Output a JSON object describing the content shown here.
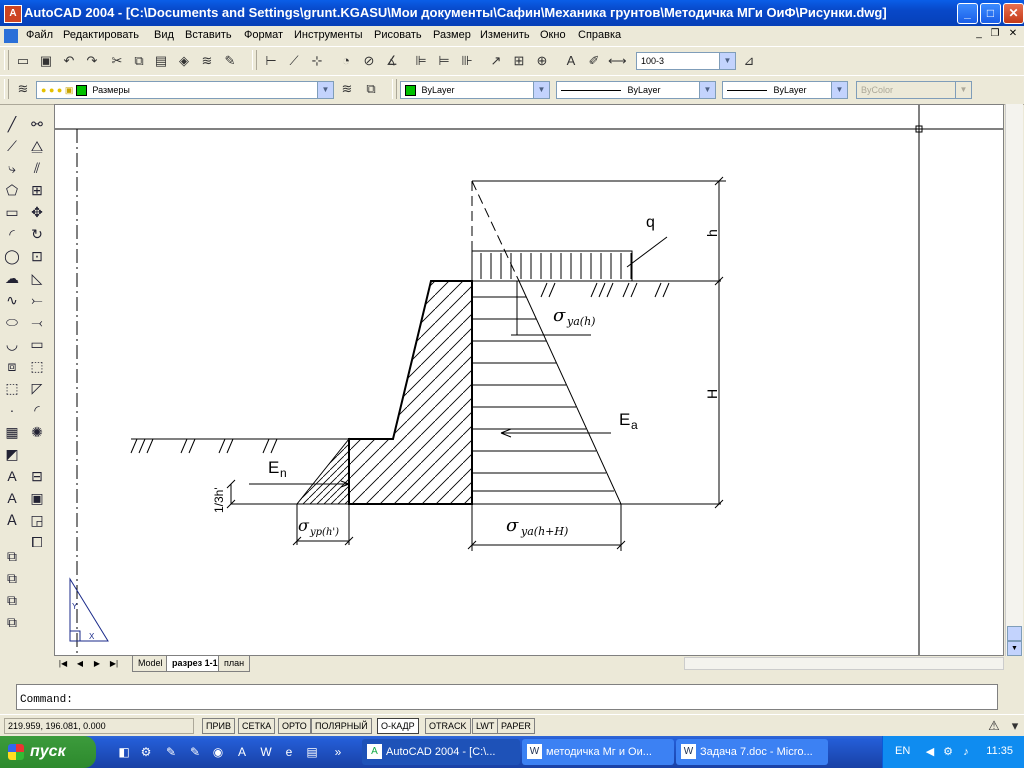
{
  "window": {
    "title": "AutoCAD 2004 - [C:\\Documents and Settings\\grunt.KGASU\\Мои документы\\Сафин\\Механика грунтов\\Методичка МГи ОиФ\\Рисунки.dwg]",
    "minimize": "_",
    "maximize": "□",
    "close": "✕"
  },
  "menu": [
    "Файл",
    "Редактировать",
    "Вид",
    "Вставить",
    "Формат",
    "Инструменты",
    "Рисовать",
    "Размер",
    "Изменить",
    "Окно",
    "Справка"
  ],
  "toolbar": {
    "dimstyle": "100-3",
    "layer": "Размеры",
    "color": "ByLayer",
    "linetype": "ByLayer",
    "lineweight": "ByLayer",
    "plotstyle": "ByColor"
  },
  "drawing": {
    "labels": {
      "q": "q",
      "h": "h",
      "H": "H",
      "Ea_base": "E",
      "Ea_sub": "a",
      "En_base": "E",
      "En_sub": "n",
      "one_third": "1/3h'",
      "sigma": "σ",
      "sigma_top_sub": "ya(h)",
      "sigma_bottom_sub": "ya(h+H)",
      "sigma_passive_sub": "yp(h')",
      "ucs_y": "Y",
      "ucs_x": "X"
    }
  },
  "layout_tabs": [
    "Model",
    "разрез 1-1",
    "план"
  ],
  "command": {
    "prompt": "Command:"
  },
  "status": {
    "coords": "219.959, 196.081, 0.000",
    "toggles": [
      "ПРИВ",
      "СЕТКА",
      "ОРТО",
      "ПОЛЯРНЫЙ",
      "О-КАДР",
      "OTRACK",
      "LWT",
      "PAPER"
    ]
  },
  "taskbar": {
    "start": "пуск",
    "items": [
      "AutoCAD 2004 - [C:\\...",
      "методичка Мг и Ои...",
      "Задача 7.doc - Micro..."
    ],
    "lang": "EN",
    "clock": "11:35"
  }
}
